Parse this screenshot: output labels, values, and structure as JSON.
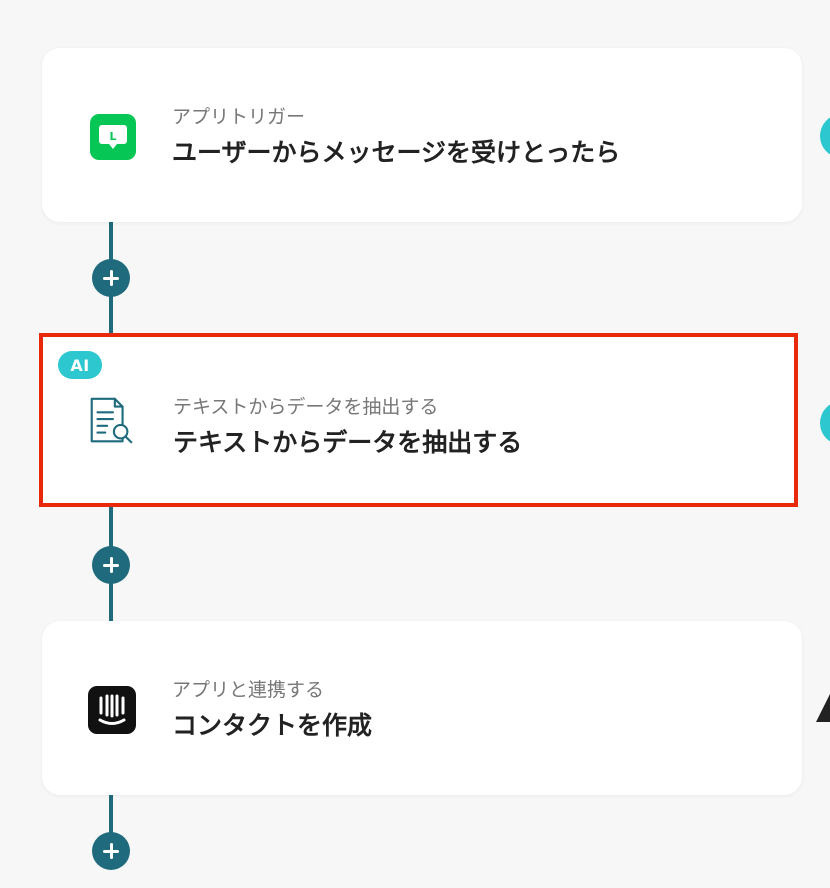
{
  "flow": {
    "steps": [
      {
        "app_icon": "line-icon",
        "subtitle": "アプリトリガー",
        "title": "ユーザーからメッセージを受けとったら"
      },
      {
        "badge": "AI",
        "app_icon": "document-search-icon",
        "subtitle": "テキストからデータを抽出する",
        "title": "テキストからデータを抽出する",
        "selected": true
      },
      {
        "app_icon": "intercom-icon",
        "subtitle": "アプリと連携する",
        "title": "コンタクトを作成"
      }
    ],
    "add_step_icon": "plus-icon",
    "colors": {
      "connector": "#1f6b7d",
      "selection_border": "#e8290b",
      "ai_badge": "#2cc7cf",
      "line_brand": "#06c755",
      "background": "#f7f7f7"
    }
  }
}
